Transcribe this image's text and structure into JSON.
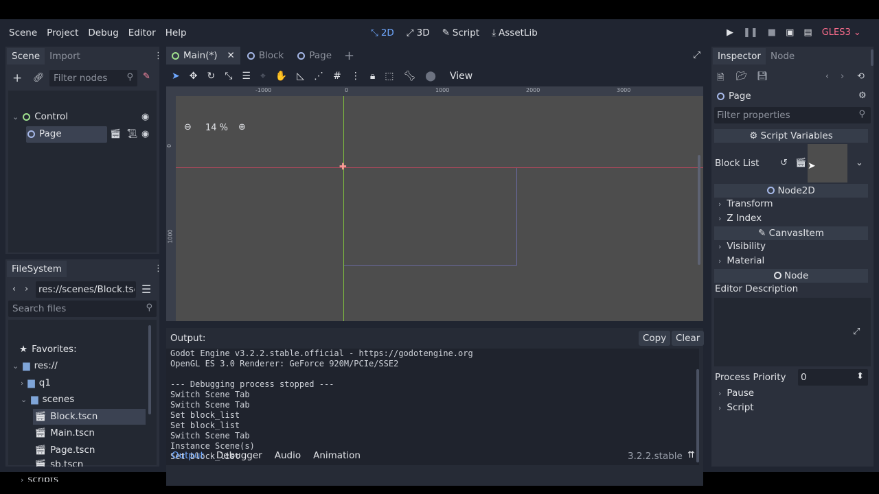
{
  "menu": [
    "Scene",
    "Project",
    "Debug",
    "Editor",
    "Help"
  ],
  "modes": [
    {
      "label": "2D",
      "icon": "2d-icon",
      "glyph": "⤡"
    },
    {
      "label": "3D",
      "icon": "3d-icon",
      "glyph": "⤢"
    },
    {
      "label": "Script",
      "icon": "script-icon",
      "glyph": "✎"
    },
    {
      "label": "AssetLib",
      "icon": "assetlib-icon",
      "glyph": "⤓"
    }
  ],
  "renderer": "GLES3",
  "scene_dock": {
    "tabs": [
      "Scene",
      "Import"
    ],
    "filter_placeholder": "Filter nodes",
    "tree": [
      {
        "label": "Control",
        "type": "control"
      },
      {
        "label": "Page",
        "type": "node2d"
      }
    ]
  },
  "filesystem": {
    "tab": "FileSystem",
    "path": "res://scenes/Block.tsc",
    "search_placeholder": "Search files",
    "items": [
      {
        "label": "Favorites:"
      },
      {
        "label": "res://"
      },
      {
        "label": "q1"
      },
      {
        "label": "scenes"
      },
      {
        "label": "Block.tscn"
      },
      {
        "label": "Main.tscn"
      },
      {
        "label": "Page.tscn"
      },
      {
        "label": "sb.tscn"
      },
      {
        "label": "scripts"
      }
    ]
  },
  "editor_tabs": [
    {
      "label": "Main(*)"
    },
    {
      "label": "Block"
    },
    {
      "label": "Page"
    }
  ],
  "toolbar": {
    "view_label": "View"
  },
  "viewport": {
    "zoom": "14 %",
    "ruler_h": [
      "-1000",
      "0",
      "1000",
      "2000",
      "3000"
    ],
    "ruler_v": [
      "0",
      "1000"
    ]
  },
  "output": {
    "title": "Output:",
    "copy_label": "Copy",
    "clear_label": "Clear",
    "lines": [
      "Godot Engine v3.2.2.stable.official - https://godotengine.org",
      "OpenGL ES 3.0 Renderer: GeForce 920M/PCIe/SSE2",
      "",
      "--- Debugging process stopped ---",
      "Switch Scene Tab",
      "Switch Scene Tab",
      "Set block_list",
      "Set block_list",
      "Switch Scene Tab",
      "Instance Scene(s)",
      "Set block_list"
    ],
    "bottom_tabs": [
      "Output",
      "Debugger",
      "Audio",
      "Animation"
    ],
    "version": "3.2.2.stable"
  },
  "inspector": {
    "tabs": [
      "Inspector",
      "Node"
    ],
    "node_name": "Page",
    "filter_placeholder": "Filter properties",
    "script_variables": "Script Variables",
    "block_list_label": "Block List",
    "node2d": "Node2D",
    "transform": "Transform",
    "z_index": "Z Index",
    "canvas_item": "CanvasItem",
    "visibility": "Visibility",
    "material": "Material",
    "node": "Node",
    "editor_description": "Editor Description",
    "process_priority_label": "Process Priority",
    "process_priority_value": "0",
    "pause": "Pause",
    "script": "Script"
  }
}
